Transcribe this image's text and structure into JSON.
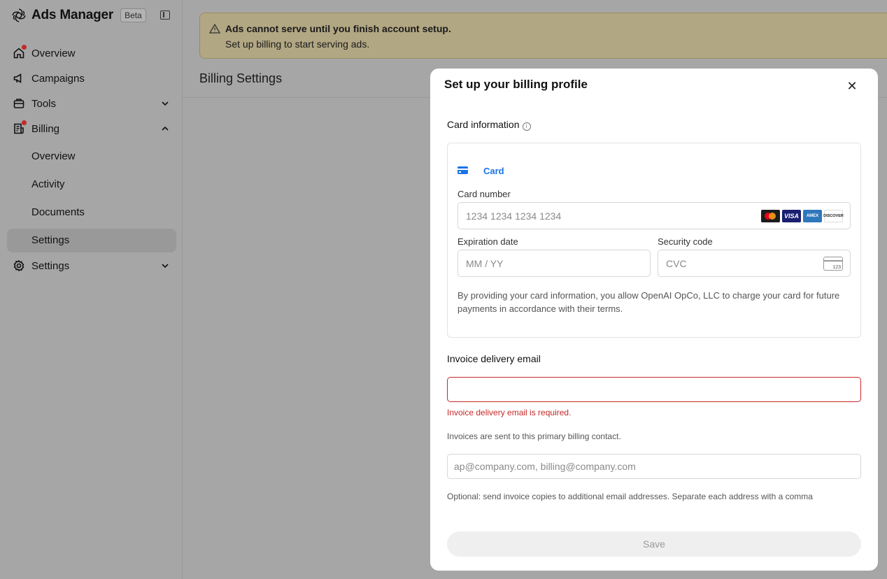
{
  "sidebar": {
    "app_name": "Ads Manager",
    "badge": "Beta",
    "items": [
      {
        "label": "Overview",
        "icon": "home-icon",
        "has_notification": true
      },
      {
        "label": "Campaigns",
        "icon": "megaphone-icon"
      },
      {
        "label": "Tools",
        "icon": "toolbox-icon",
        "expanded": false
      },
      {
        "label": "Billing",
        "icon": "receipt-icon",
        "has_notification": true,
        "expanded": true
      },
      {
        "label": "Settings",
        "icon": "gear-icon",
        "expanded": false
      }
    ],
    "billing_subitems": [
      {
        "label": "Overview"
      },
      {
        "label": "Activity"
      },
      {
        "label": "Documents"
      },
      {
        "label": "Settings",
        "active": true
      }
    ]
  },
  "banner": {
    "title": "Ads cannot serve until you finish account setup.",
    "message": "Set up billing to start serving ads."
  },
  "page": {
    "title": "Billing Settings"
  },
  "modal": {
    "title": "Set up your billing profile",
    "card_section_label": "Card information",
    "card_tab": "Card",
    "card_number_label": "Card number",
    "card_number_placeholder": "1234 1234 1234 1234",
    "card_brands": {
      "mastercard": "",
      "visa": "VISA",
      "amex": "AMEX",
      "discover": "DISCOVER"
    },
    "expiration_label": "Expiration date",
    "expiration_placeholder": "MM / YY",
    "security_label": "Security code",
    "security_placeholder": "CVC",
    "cvc_icon_text": "123",
    "terms": "By providing your card information, you allow OpenAI OpCo, LLC to charge your card for future payments in accordance with their terms.",
    "invoice_email_label": "Invoice delivery email",
    "invoice_email_value": "",
    "invoice_email_error": "Invoice delivery email is required.",
    "invoice_email_help": "Invoices are sent to this primary billing contact.",
    "cc_placeholder": "ap@company.com, billing@company.com",
    "cc_help": "Optional: send invoice copies to additional email addresses. Separate each address with a comma",
    "save_label": "Save"
  },
  "colors": {
    "accent": "#1a73e8",
    "error": "#c62828",
    "overlay": "#a6a6a6",
    "banner_bg": "#b2a783"
  }
}
